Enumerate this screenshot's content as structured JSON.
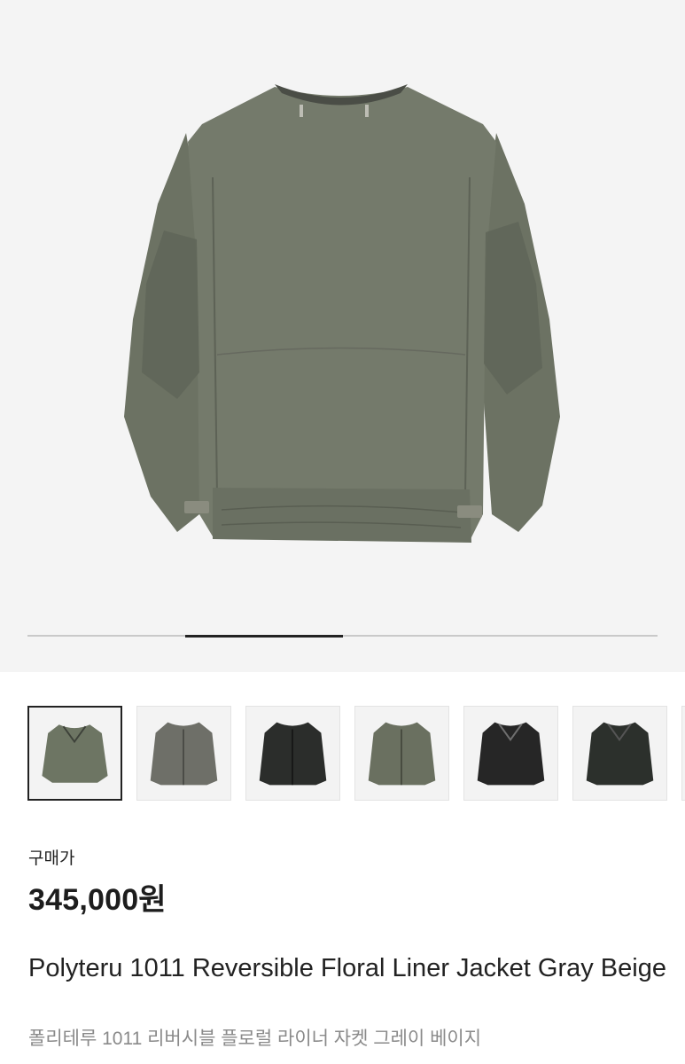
{
  "hero": {
    "image_icon": "jacket-back-photo",
    "colors": {
      "background": "#f4f4f4",
      "fabric": "#747a6b",
      "fabric_shadow": "#5f6558",
      "collar": "#4a4d46"
    },
    "pager": {
      "total": 4,
      "active_index": 1
    }
  },
  "thumbnails": [
    {
      "icon": "jacket-thumbnail-olive-quilted",
      "color": "#6d7563",
      "selected": true
    },
    {
      "icon": "jacket-thumbnail-gray-zip",
      "color": "#6e6f68",
      "selected": false
    },
    {
      "icon": "jacket-thumbnail-black",
      "color": "#2b2d2b",
      "selected": false
    },
    {
      "icon": "jacket-thumbnail-olive-zip",
      "color": "#6a7060",
      "selected": false
    },
    {
      "icon": "jacket-thumbnail-black-quilted",
      "color": "#262626",
      "selected": false
    },
    {
      "icon": "jacket-thumbnail-dark-green",
      "color": "#2c302c",
      "selected": false
    }
  ],
  "product": {
    "price_label": "구매가",
    "price": "345,000원",
    "title": "Polyteru 1011 Reversible Floral Liner Jacket Gray Beige",
    "subtitle": "폴리테루 1011 리버시블 플로럴 라이너 자켓 그레이 베이지"
  }
}
